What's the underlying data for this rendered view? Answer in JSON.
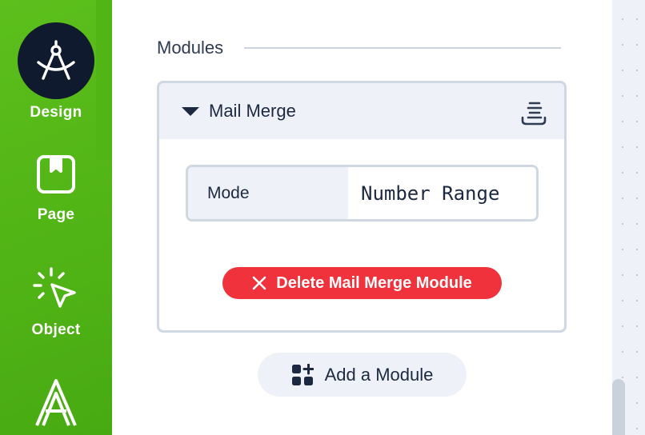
{
  "sidebar": {
    "items": [
      {
        "label": "Design",
        "icon": "compass-icon",
        "active": true
      },
      {
        "label": "Page",
        "icon": "bookmark-page-icon",
        "active": false
      },
      {
        "label": "Object",
        "icon": "cursor-click-icon",
        "active": false
      },
      {
        "label": "",
        "icon": "text-a-icon",
        "active": false
      }
    ],
    "color": "#52b516",
    "active_color": "#0f1a2e"
  },
  "main": {
    "section_title": "Modules",
    "module": {
      "title": "Mail Merge",
      "expanded": true,
      "mode_label": "Mode",
      "mode_value": "Number Range",
      "delete_label": "Delete Mail Merge Module"
    },
    "add_module_label": "Add a Module"
  },
  "colors": {
    "danger": "#f0323c",
    "text": "#1d2940",
    "panel_bg": "#eef2f8",
    "border": "#cfd7e2"
  }
}
